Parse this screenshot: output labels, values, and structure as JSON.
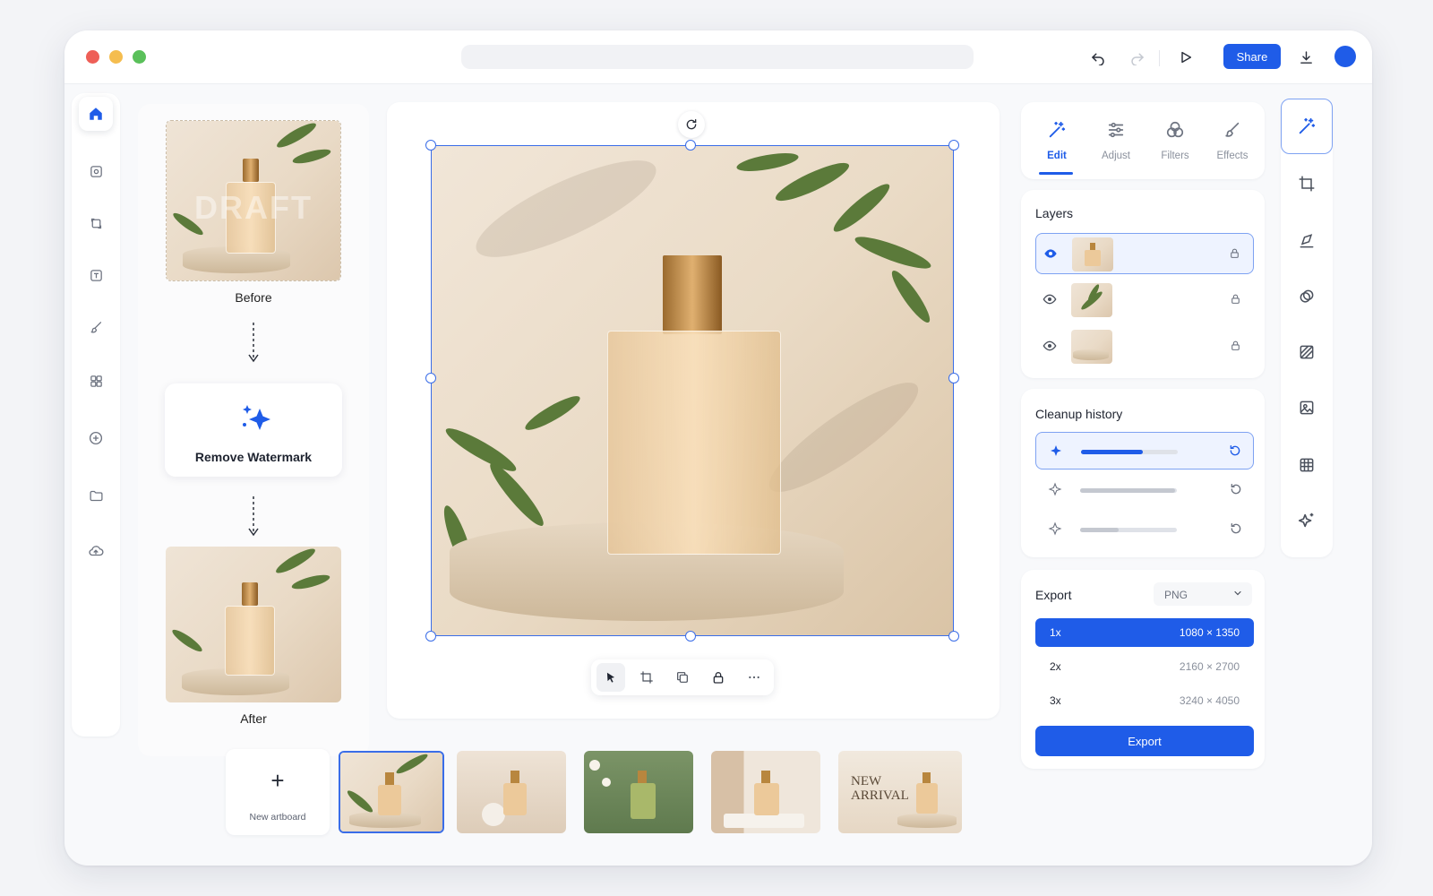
{
  "titlebar": {
    "share_label": "Share"
  },
  "flow": {
    "before_label": "Before",
    "watermark_text": "DRAFT",
    "action_label": "Remove Watermark",
    "after_label": "After"
  },
  "tabs": [
    {
      "label": "Edit",
      "icon": "magic-wand-icon"
    },
    {
      "label": "Adjust",
      "icon": "sliders-icon"
    },
    {
      "label": "Filters",
      "icon": "filters-icon"
    },
    {
      "label": "Effects",
      "icon": "brush-icon"
    }
  ],
  "layers": {
    "title": "Layers"
  },
  "history": {
    "title": "Cleanup history",
    "rows": [
      {
        "progress": 0.64,
        "color": "#1f5ce8"
      },
      {
        "progress": 0.98,
        "color": "#c4c8d0"
      },
      {
        "progress": 0.4,
        "color": "#c4c8d0"
      }
    ]
  },
  "export": {
    "title": "Export",
    "format": "PNG",
    "scales": [
      {
        "scale": "1x",
        "size": "1080 × 1350"
      },
      {
        "scale": "2x",
        "size": "2160 × 2700"
      },
      {
        "scale": "3x",
        "size": "3240 × 4050"
      }
    ],
    "button_label": "Export"
  },
  "filmstrip": {
    "new_artboard_label": "New artboard",
    "new_arrival_text": "NEW ARRIVAL"
  },
  "colors": {
    "accent": "#1f5ce8",
    "selection": "#3a6de8"
  }
}
